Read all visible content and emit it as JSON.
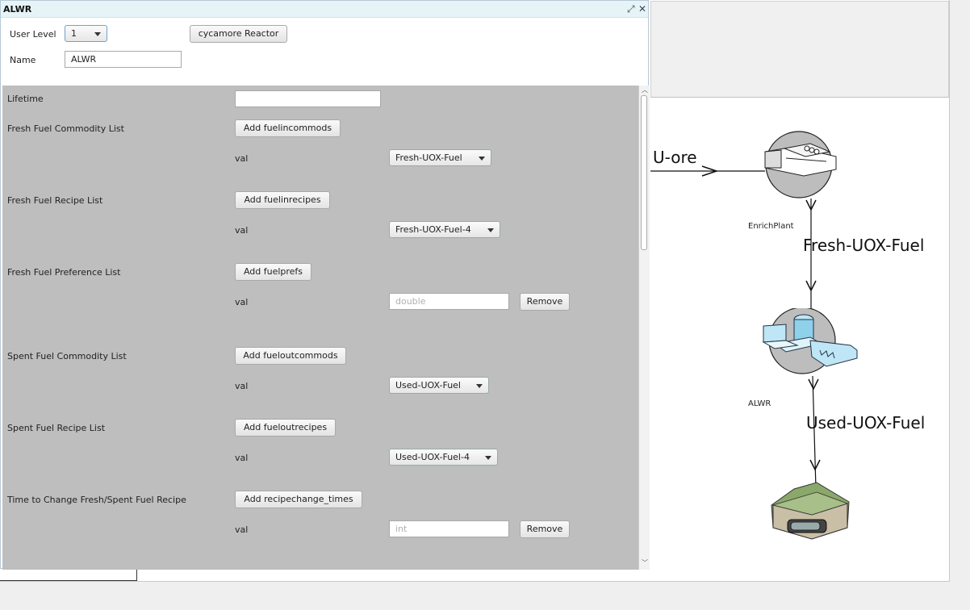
{
  "window": {
    "title": "ALWR",
    "header": {
      "user_level_label": "User Level",
      "user_level_value": "1",
      "name_label": "Name",
      "name_value": "ALWR",
      "archetype_button": "cycamore Reactor"
    },
    "form": {
      "lifetime_label": "Lifetime",
      "lifetime_value": "",
      "sections": [
        {
          "label": "Fresh Fuel Commodity List",
          "button": "Add fuelincommods",
          "val_label": "val",
          "value": "Fresh-UOX-Fuel"
        },
        {
          "label": "Fresh Fuel Recipe List",
          "button": "Add fuelinrecipes",
          "val_label": "val",
          "value": "Fresh-UOX-Fuel-4"
        },
        {
          "label": "Fresh Fuel Preference List",
          "button": "Add fuelprefs",
          "val_label": "val",
          "placeholder": "double",
          "remove": "Remove"
        },
        {
          "label": "Spent Fuel Commodity List",
          "button": "Add fueloutcommods",
          "val_label": "val",
          "value": "Used-UOX-Fuel"
        },
        {
          "label": "Spent Fuel Recipe List",
          "button": "Add fueloutrecipes",
          "val_label": "val",
          "value": "Used-UOX-Fuel-4"
        },
        {
          "label": "Time to Change Fresh/Spent Fuel Recipe",
          "button": "Add recipechange_times",
          "val_label": "val",
          "placeholder": "int",
          "remove": "Remove"
        }
      ]
    }
  },
  "graph": {
    "edge_uore": "U-ore",
    "node_enrich": "EnrichPlant",
    "edge_fresh": "Fresh-UOX-Fuel",
    "node_alwr": "ALWR",
    "edge_used": "Used-UOX-Fuel",
    "icons": [
      "enrichment-plant-icon",
      "reactor-icon",
      "repository-icon"
    ]
  },
  "colors": {
    "titlebar": "#e6f4f8",
    "form_bg": "#bebebe",
    "reactor_blue": "#bfe6f6"
  }
}
